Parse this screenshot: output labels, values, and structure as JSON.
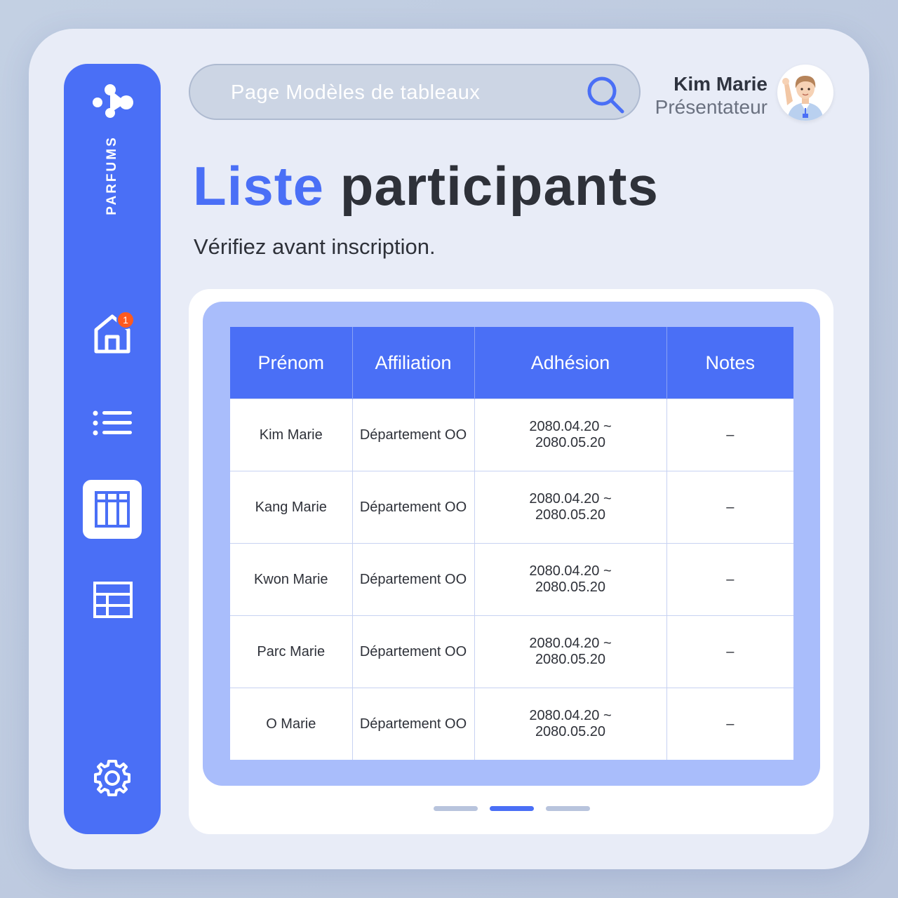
{
  "sidebar": {
    "brand": "PARFUMS",
    "notification_count": "1",
    "items": [
      {
        "icon": "home-icon"
      },
      {
        "icon": "list-icon"
      },
      {
        "icon": "table-icon",
        "active": true
      },
      {
        "icon": "grid-icon"
      },
      {
        "icon": "gear-icon"
      }
    ]
  },
  "search": {
    "placeholder": "Page Modèles de tableaux",
    "icon": "search-icon"
  },
  "user": {
    "name": "Kim Marie",
    "role": "Présentateur"
  },
  "page": {
    "title_accent": "Liste",
    "title_rest": "participants",
    "subtitle": "Vérifiez avant inscription."
  },
  "table": {
    "headers": [
      "Prénom",
      "Affiliation",
      "Adhésion",
      "Notes"
    ],
    "rows": [
      {
        "name": "Kim Marie",
        "affiliation": "Département OO",
        "start": "2080.04.20 ~",
        "end": "2080.05.20",
        "notes": "–"
      },
      {
        "name": "Kang Marie",
        "affiliation": "Département OO",
        "start": "2080.04.20 ~",
        "end": "2080.05.20",
        "notes": "–"
      },
      {
        "name": "Kwon Marie",
        "affiliation": "Département OO",
        "start": "2080.04.20 ~",
        "end": "2080.05.20",
        "notes": "–"
      },
      {
        "name": "Parc Marie",
        "affiliation": "Département OO",
        "start": "2080.04.20 ~",
        "end": "2080.05.20",
        "notes": "–"
      },
      {
        "name": "O Marie",
        "affiliation": "Département OO",
        "start": "2080.04.20 ~",
        "end": "2080.05.20",
        "notes": "–"
      }
    ]
  },
  "pagination": {
    "pages": 3,
    "current": 2
  },
  "colors": {
    "accent": "#4a6ff6",
    "badge": "#ff5a1f",
    "panel": "#a9bdfb"
  }
}
